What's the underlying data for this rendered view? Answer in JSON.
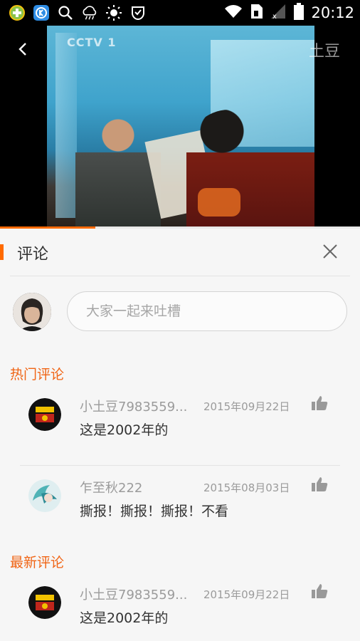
{
  "status_bar": {
    "time": "20:12",
    "left_icons": [
      "plus-circle-icon",
      "k-app-icon",
      "search-icon",
      "cloud-rain-icon",
      "sun-icon",
      "shield-check-icon"
    ],
    "right_icons": [
      "wifi-icon",
      "sim-icon",
      "signal-icon",
      "battery-icon"
    ]
  },
  "video": {
    "logo_text": "CCTV 1",
    "brand": "土豆",
    "progress": 0.265
  },
  "comments_panel": {
    "title": "评论",
    "input_placeholder": "大家一起来吐槽",
    "hot_section_title": "热门评论",
    "new_section_title": "最新评论",
    "hot_comments": [
      {
        "user": "小土豆7983559...",
        "date": "2015年09月22日",
        "text": "这是2002年的"
      },
      {
        "user": "乍至秋222",
        "date": "2015年08月03日",
        "text": "撕报！撕报！撕报！不看"
      }
    ],
    "new_comments": [
      {
        "user": "小土豆7983559...",
        "date": "2015年09月22日",
        "text": "这是2002年的"
      }
    ]
  },
  "colors": {
    "accent": "#ff6a00",
    "section_title": "#f06414",
    "meta_text": "#9b9b9b"
  }
}
